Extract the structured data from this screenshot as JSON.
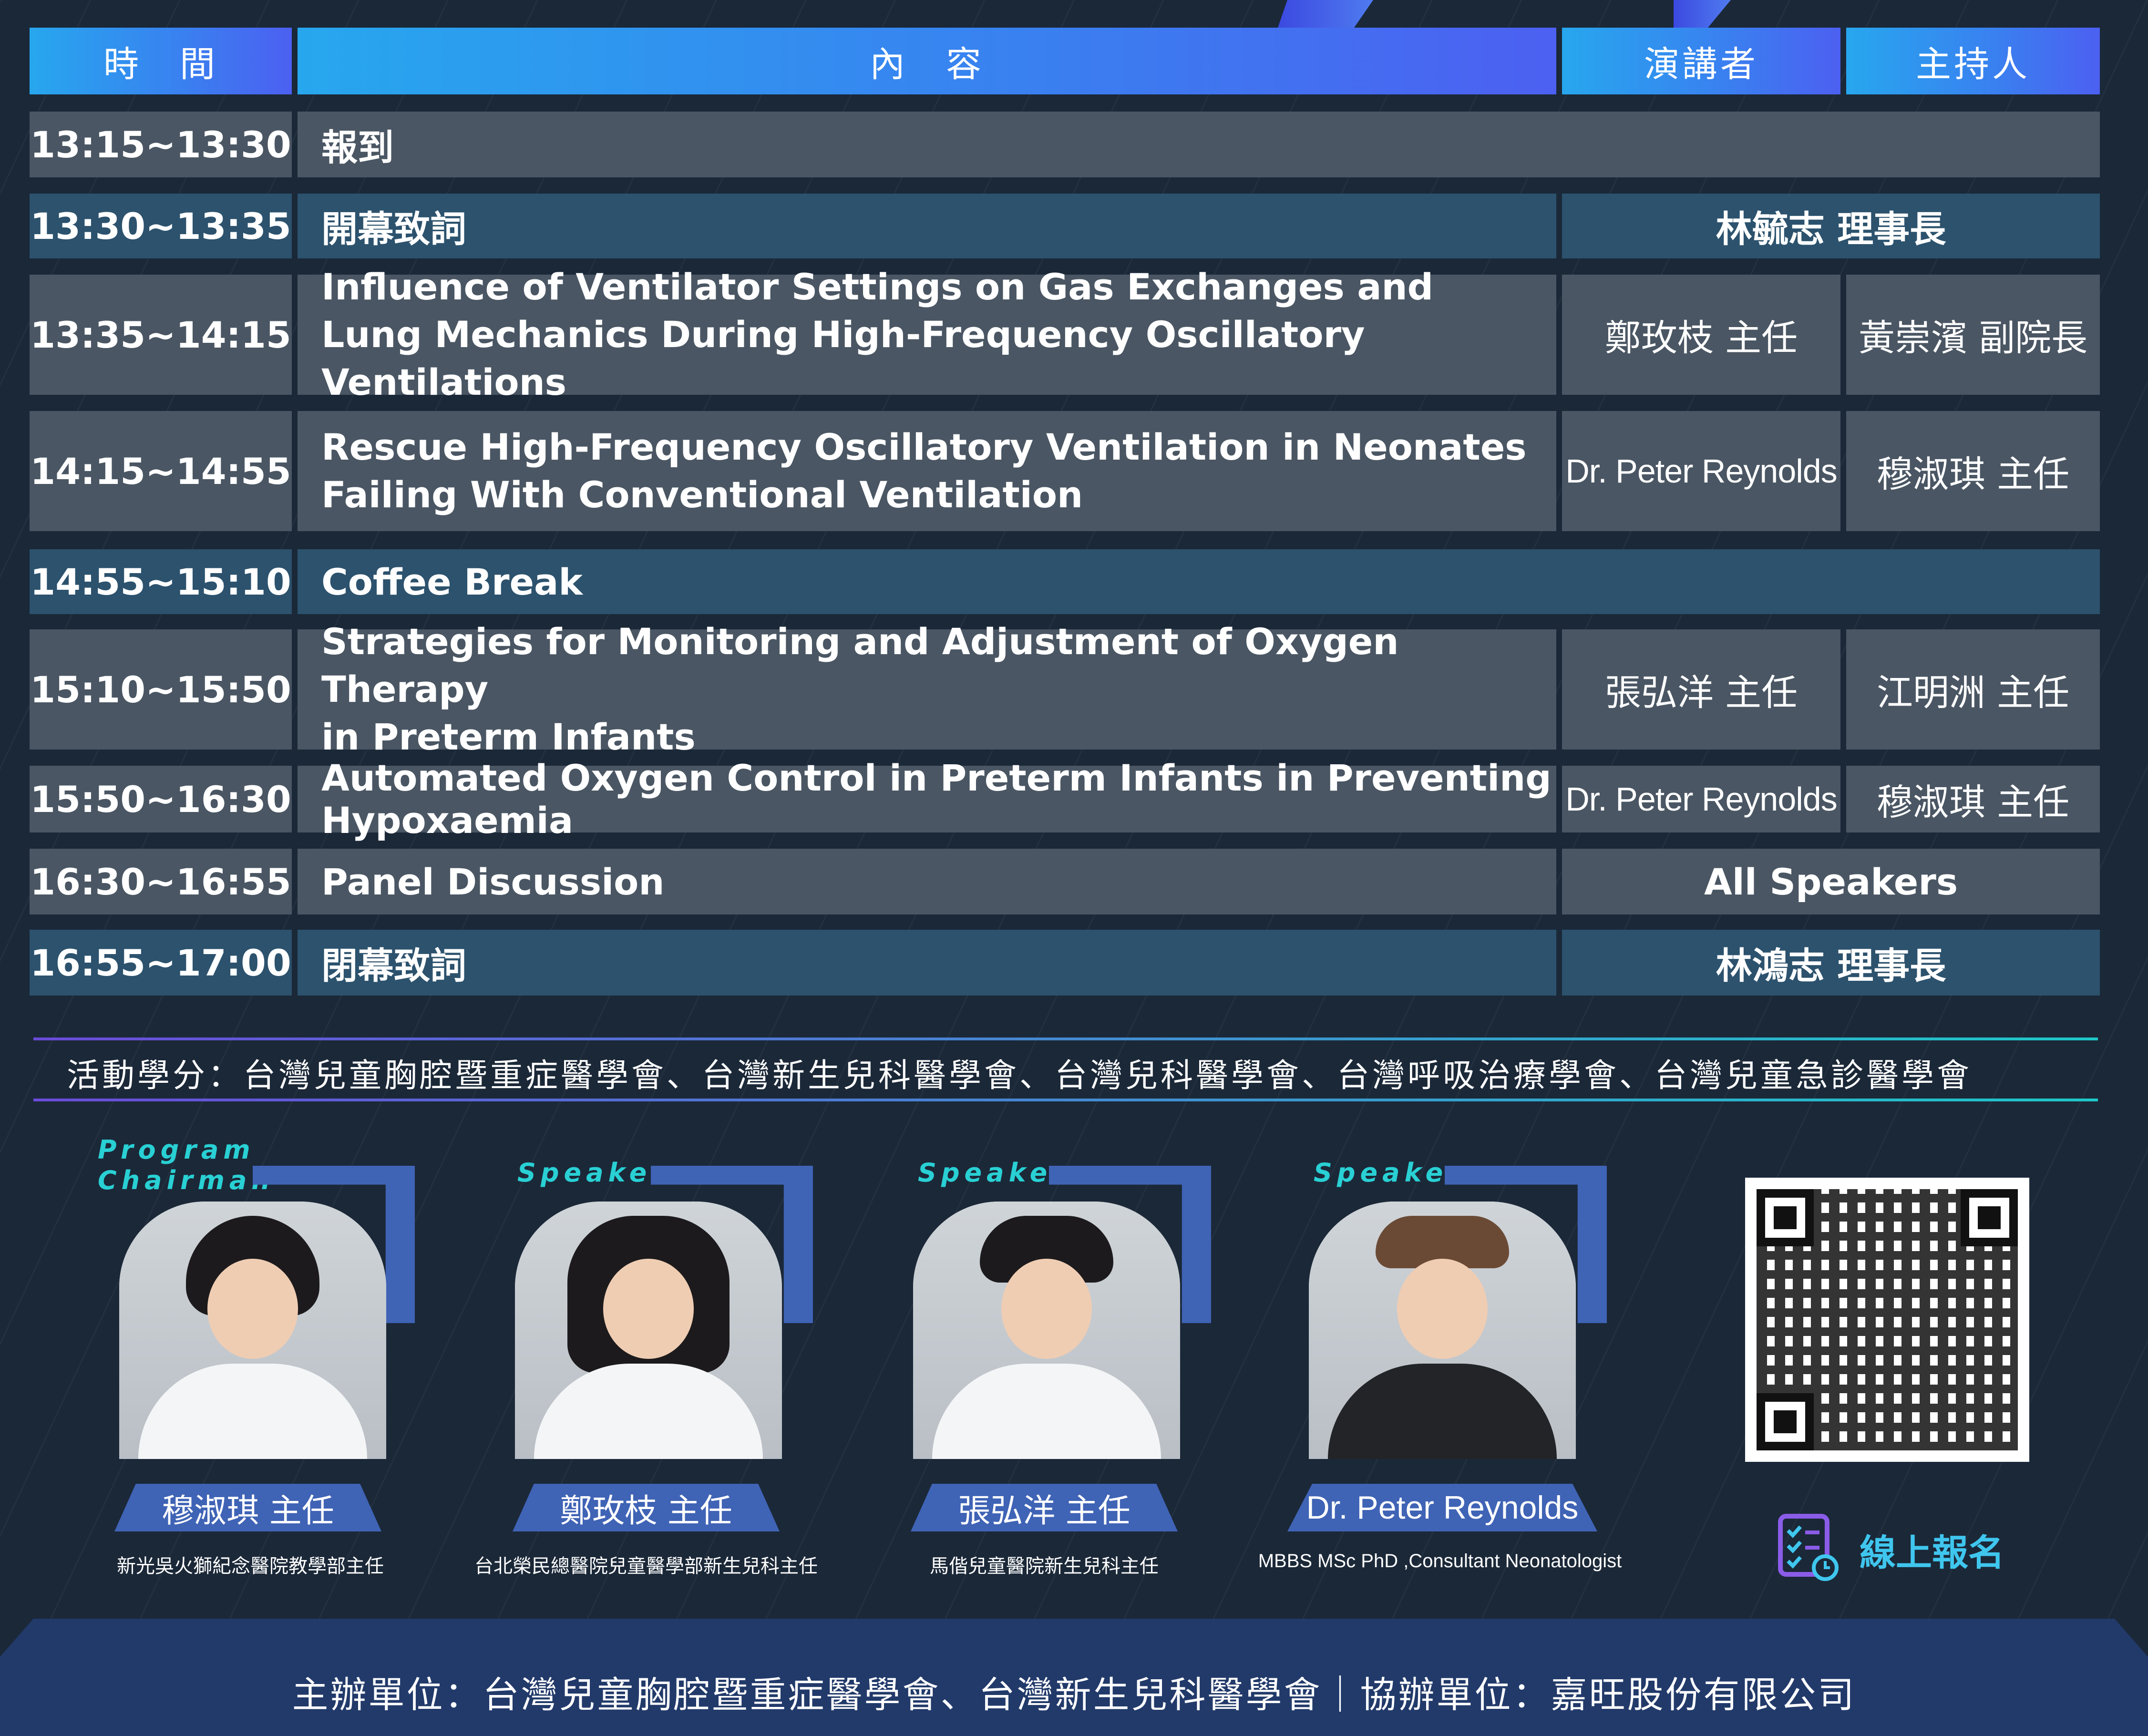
{
  "header": {
    "time": "時　間",
    "content": "內　容",
    "speaker": "演講者",
    "host": "主持人"
  },
  "rows": [
    {
      "time": "13:15~13:30",
      "content": "報到"
    },
    {
      "time": "13:30~13:35",
      "content": "開幕致詞",
      "merged": "林毓志  理事長"
    },
    {
      "time": "13:35~14:15",
      "content_l1": "Influence of Ventilator Settings on Gas Exchanges and",
      "content_l2": "Lung Mechanics During High-Frequency Oscillatory Ventilations",
      "speaker": "鄭玫枝 主任",
      "host": "黃崇濱 副院長"
    },
    {
      "time": "14:15~14:55",
      "content_l1": "Rescue High-Frequency Oscillatory Ventilation in Neonates",
      "content_l2": "Failing With Conventional Ventilation",
      "speaker": "Dr. Peter Reynolds",
      "host": "穆淑琪 主任"
    },
    {
      "time": "14:55~15:10",
      "content": "Coffee Break"
    },
    {
      "time": "15:10~15:50",
      "content_l1": "Strategies for Monitoring and Adjustment of Oxygen Therapy",
      "content_l2": "in Preterm Infants",
      "speaker": "張弘洋 主任",
      "host": "江明洲 主任"
    },
    {
      "time": "15:50~16:30",
      "content": "Automated Oxygen Control in Preterm Infants in Preventing Hypoxaemia",
      "speaker": "Dr. Peter Reynolds",
      "host": "穆淑琪 主任"
    },
    {
      "time": "16:30~16:55",
      "content": "Panel Discussion",
      "merged": "All Speakers"
    },
    {
      "time": "16:55~17:00",
      "content": "閉幕致詞",
      "merged": "林鴻志  理事長"
    }
  ],
  "credits": "活動學分：台灣兒童胸腔暨重症醫學會、台灣新生兒科醫學會、台灣兒科醫學會、台灣呼吸治療學會、台灣兒童急診醫學會",
  "people": [
    {
      "role": "Program\nChairman",
      "name": "穆淑琪 主任",
      "affil": "新光吳火獅紀念醫院教學部主任"
    },
    {
      "role": "Speaker",
      "name": "鄭玫枝 主任",
      "affil": "台北榮民總醫院兒童醫學部新生兒科主任"
    },
    {
      "role": "Speaker",
      "name": "張弘洋 主任",
      "affil": "馬偕兒童醫院新生兒科主任"
    },
    {
      "role": "Speaker",
      "name": "Dr. Peter Reynolds",
      "affil": "MBBS MSc PhD ,Consultant Neonatologist"
    }
  ],
  "signup": {
    "label": "線上報名",
    "icon": "checklist-icon"
  },
  "footer": "主辦單位：台灣兒童胸腔暨重症醫學會、台灣新生兒科醫學會｜協辦單位：嘉旺股份有限公司",
  "colors": {
    "background": "#1b2838",
    "header_gradient_start": "#27a7ee",
    "header_gradient_end": "#4c60f1",
    "row_gray": "#4a5663",
    "row_blue": "#2c526d",
    "accent_cyan": "#29d0d4",
    "frame_blue": "#3f63b5"
  }
}
